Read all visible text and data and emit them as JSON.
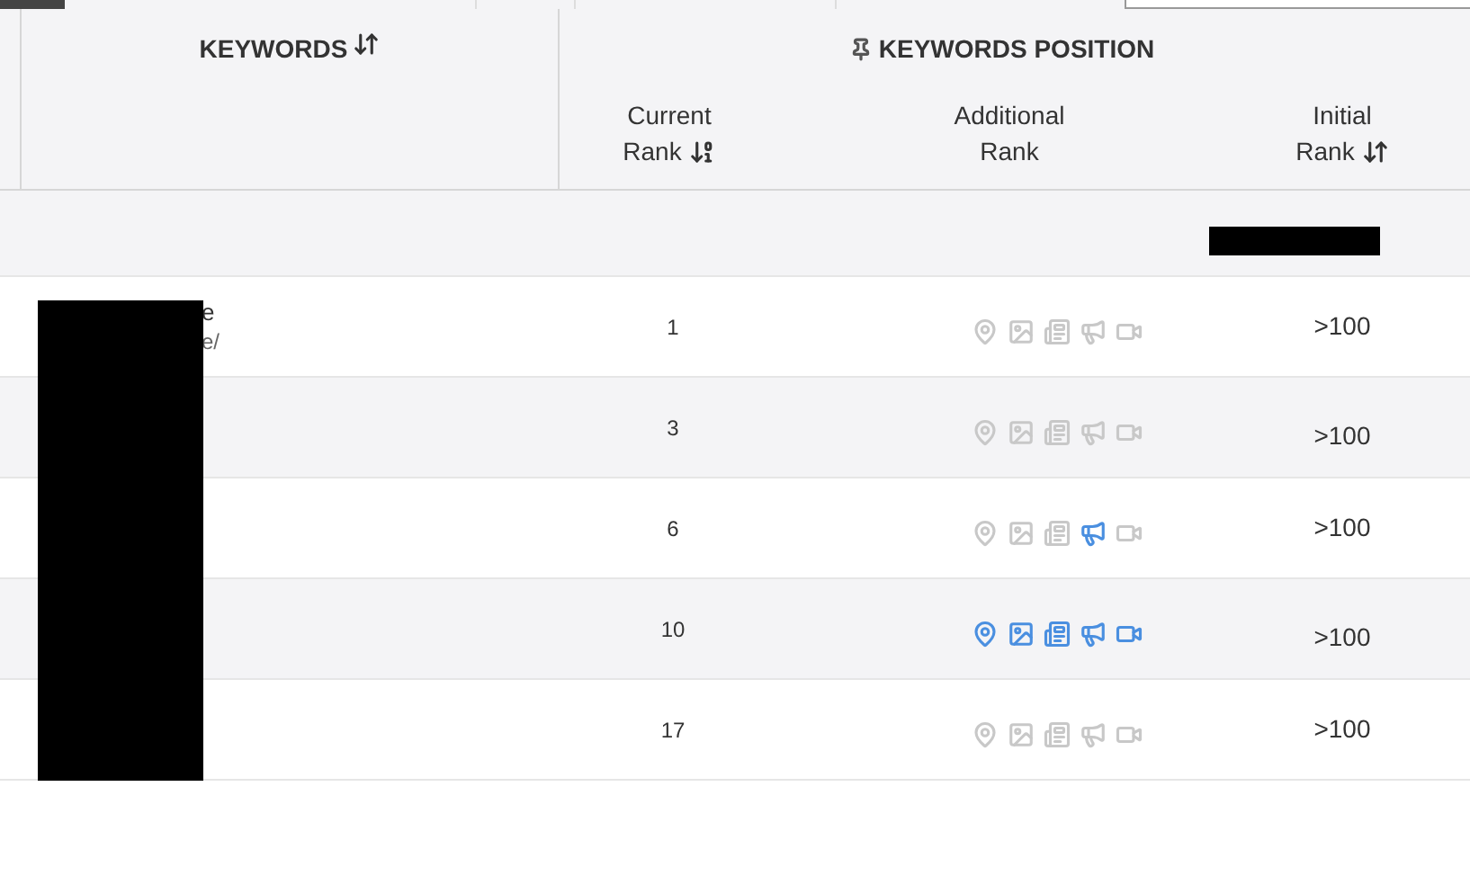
{
  "header": {
    "keywords": {
      "label": "KEYWORDS",
      "kind": "both"
    },
    "group_label": "KEYWORDS POSITION",
    "columns": [
      {
        "line1": "Current",
        "line2": "Rank",
        "kind": "numeric"
      },
      {
        "line1": "Additional",
        "line2": "Rank",
        "kind": "plain"
      },
      {
        "line1": "Initial",
        "line2": "Rank",
        "kind": "both"
      }
    ]
  },
  "rows": [
    {
      "keyword": "e",
      "url": "e/",
      "current_rank": "1",
      "initial_rank": ">100",
      "features": [
        {
          "kind": "pin",
          "active": false
        },
        {
          "kind": "image",
          "active": false
        },
        {
          "kind": "news",
          "active": false
        },
        {
          "kind": "ads",
          "active": false
        },
        {
          "kind": "video",
          "active": false
        }
      ]
    },
    {
      "current_rank": "3",
      "initial_rank": ">100",
      "features": [
        {
          "kind": "pin",
          "active": false
        },
        {
          "kind": "image",
          "active": false
        },
        {
          "kind": "news",
          "active": false
        },
        {
          "kind": "ads",
          "active": false
        },
        {
          "kind": "video",
          "active": false
        }
      ]
    },
    {
      "current_rank": "6",
      "initial_rank": ">100",
      "features": [
        {
          "kind": "pin",
          "active": false
        },
        {
          "kind": "image",
          "active": false
        },
        {
          "kind": "news",
          "active": false
        },
        {
          "kind": "ads",
          "active": true
        },
        {
          "kind": "video",
          "active": false
        }
      ]
    },
    {
      "current_rank": "10",
      "initial_rank": ">100",
      "features": [
        {
          "kind": "pin",
          "active": true
        },
        {
          "kind": "image",
          "active": true
        },
        {
          "kind": "news",
          "active": true
        },
        {
          "kind": "ads",
          "active": true
        },
        {
          "kind": "video",
          "active": true
        }
      ]
    },
    {
      "current_rank": "17",
      "initial_rank": ">100",
      "features": [
        {
          "kind": "pin",
          "active": false
        },
        {
          "kind": "image",
          "active": false
        },
        {
          "kind": "news",
          "active": false
        },
        {
          "kind": "ads",
          "active": false
        },
        {
          "kind": "video",
          "active": false
        }
      ]
    }
  ]
}
